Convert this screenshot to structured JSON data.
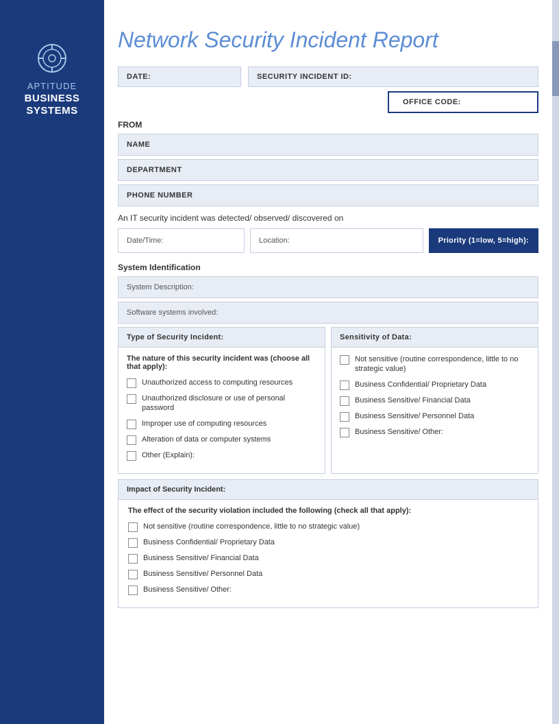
{
  "sidebar": {
    "icon_label": "target-icon",
    "aptitude_label": "APTITUDE",
    "business_label": "BUSINESS\nSYSTEMS"
  },
  "header": {
    "title": "Network Security Incident Report"
  },
  "form": {
    "date_label": "DATE:",
    "security_incident_id_label": "SECURITY INCIDENT ID:",
    "office_code_label": "OFFICE CODE:",
    "from_label": "FROM",
    "name_label": "NAME",
    "department_label": "DEPARTMENT",
    "phone_label": "PHONE NUMBER",
    "incident_detected_text": "An IT security incident was detected/ observed/ discovered on",
    "datetime_label": "Date/Time:",
    "location_label": "Location:",
    "priority_label": "Priority (1=low, 5=high):",
    "system_identification_label": "System Identification",
    "system_description_label": "System Description:",
    "software_systems_label": "Software systems involved:",
    "type_of_incident_label": "Type of Security Incident:",
    "nature_text": "The nature of this security incident was (choose all that apply):",
    "checkboxes_incident": [
      "Unauthorized access to computing resources",
      "Unauthorized disclosure or use of personal password",
      "Improper use of computing resources",
      "Alteration of data or computer systems",
      "Other (Explain):"
    ],
    "sensitivity_label": "Sensitivity of Data:",
    "checkboxes_sensitivity": [
      "Not sensitive (routine correspondence, little to no strategic value)",
      "Business Confidential/ Proprietary Data",
      "Business Sensitive/ Financial Data",
      "Business Sensitive/ Personnel Data",
      "Business Sensitive/ Other:"
    ],
    "impact_label": "Impact of Security Incident:",
    "impact_intro": "The effect of the security violation included the following (check all that apply):",
    "checkboxes_impact": [
      "Not sensitive (routine correspondence, little to no strategic value)",
      "Business Confidential/ Proprietary Data",
      "Business Sensitive/ Financial Data",
      "Business Sensitive/ Personnel Data",
      "Business Sensitive/ Other:"
    ]
  },
  "colors": {
    "sidebar_bg": "#1a3a7c",
    "field_bg": "#e8edf5",
    "priority_bg": "#1a3a7c",
    "title_color": "#5b8dd4"
  }
}
